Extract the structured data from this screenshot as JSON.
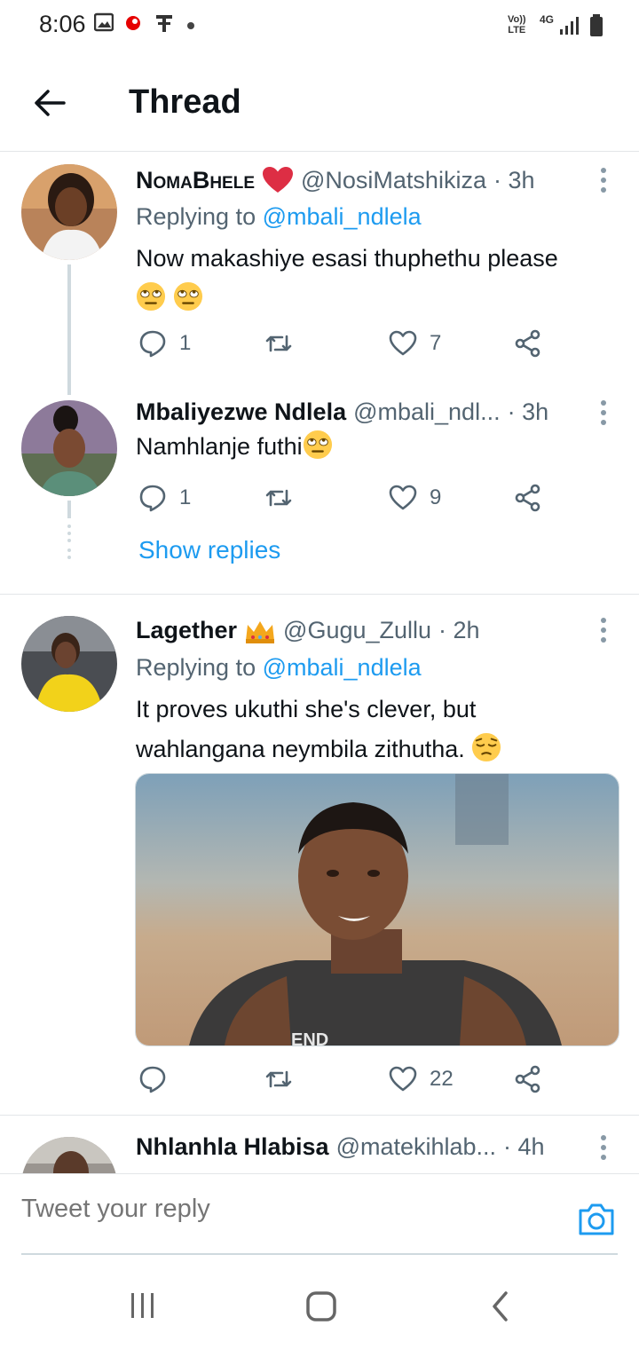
{
  "status_bar": {
    "time": "8:06",
    "network_label_top": "Vo))",
    "network_label_bottom": "LTE",
    "network_type": "4G"
  },
  "header": {
    "title": "Thread"
  },
  "tweets": [
    {
      "display_name": "NomaBhele",
      "handle": "@NosiMatshikiza",
      "time": "· 3h",
      "replying_prefix": "Replying to",
      "replying_to": "@mbali_ndlela",
      "text_line1": "Now makashiye esasi thuphethu please",
      "replies": "1",
      "likes": "7"
    },
    {
      "display_name": "Mbaliyezwe Ndlela",
      "handle": "@mbali_ndl...",
      "time": "· 3h",
      "text": "Namhlanje futhi",
      "replies": "1",
      "likes": "9"
    },
    {
      "display_name": "Lagether",
      "handle": "@Gugu_Zullu",
      "time": "· 2h",
      "replying_prefix": "Replying to",
      "replying_to": "@mbali_ndlela",
      "text_line1": "It proves ukuthi she's clever, but",
      "text_line2": "wahlangana neymbila zithutha.",
      "likes": "22"
    },
    {
      "display_name": "Nhlanhla Hlabisa",
      "handle": "@matekihlab...",
      "time": "· 4h"
    }
  ],
  "show_replies_label": "Show replies",
  "composer": {
    "placeholder": "Tweet your reply"
  },
  "colors": {
    "accent": "#1d9bf0",
    "secondary_text": "#536471",
    "primary_text": "#0f1419",
    "heart": "#e0245e"
  }
}
